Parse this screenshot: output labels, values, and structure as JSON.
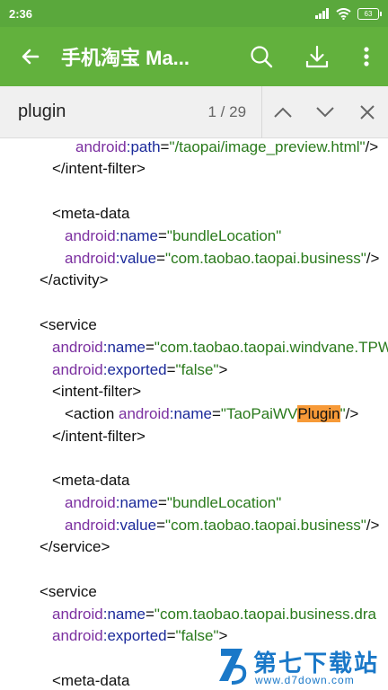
{
  "status_bar": {
    "time": "2:36",
    "battery": "63"
  },
  "toolbar": {
    "title": "手机淘宝 Ma...",
    "icons": [
      "back-arrow-icon",
      "search-icon",
      "download-icon",
      "more-vert-icon"
    ]
  },
  "find_bar": {
    "query": "plugin",
    "match_count": "1 / 29"
  },
  "code": {
    "l0": {
      "ns": "android",
      "attr": ":path",
      "eq": "=",
      "val": "\"/taopai/image_preview.html\"",
      "tail": "/>"
    },
    "l1": "</intent-filter>",
    "l3": "<meta-data",
    "l4": {
      "ns": "android",
      "attr": ":name",
      "eq": "=",
      "val": "\"bundleLocation\""
    },
    "l5": {
      "ns": "android",
      "attr": ":value",
      "eq": "=",
      "val": "\"com.taobao.taopai.business\"",
      "tail": "/>"
    },
    "l6": "</activity>",
    "l8": "<service",
    "l9": {
      "ns": "android",
      "attr": ":name",
      "eq": "=",
      "val": "\"com.taobao.taopai.windvane.TPWVPlugin\""
    },
    "l10": {
      "ns": "android",
      "attr": ":exported",
      "eq": "=",
      "val": "\"false\"",
      "tail": ">"
    },
    "l11": "<intent-filter>",
    "l12": {
      "pre": "<action ",
      "ns": "android",
      "attr": ":name",
      "eq": "=",
      "val_a": "\"TaoPaiWV",
      "val_hl": "Plugin",
      "val_b": "\"",
      "tail": "/>"
    },
    "l13": "</intent-filter>",
    "l15": "<meta-data",
    "l16": {
      "ns": "android",
      "attr": ":name",
      "eq": "=",
      "val": "\"bundleLocation\""
    },
    "l17": {
      "ns": "android",
      "attr": ":value",
      "eq": "=",
      "val": "\"com.taobao.taopai.business\"",
      "tail": "/>"
    },
    "l18": "</service>",
    "l20": "<service",
    "l21": {
      "ns": "android",
      "attr": ":name",
      "eq": "=",
      "val": "\"com.taobao.taopai.business.dra"
    },
    "l22": {
      "ns": "android",
      "attr": ":exported",
      "eq": "=",
      "val": "\"false\"",
      "tail": ">"
    },
    "l24": "<meta-data"
  },
  "watermark": {
    "title": "第七下载站",
    "url": "www.d7down.com"
  }
}
